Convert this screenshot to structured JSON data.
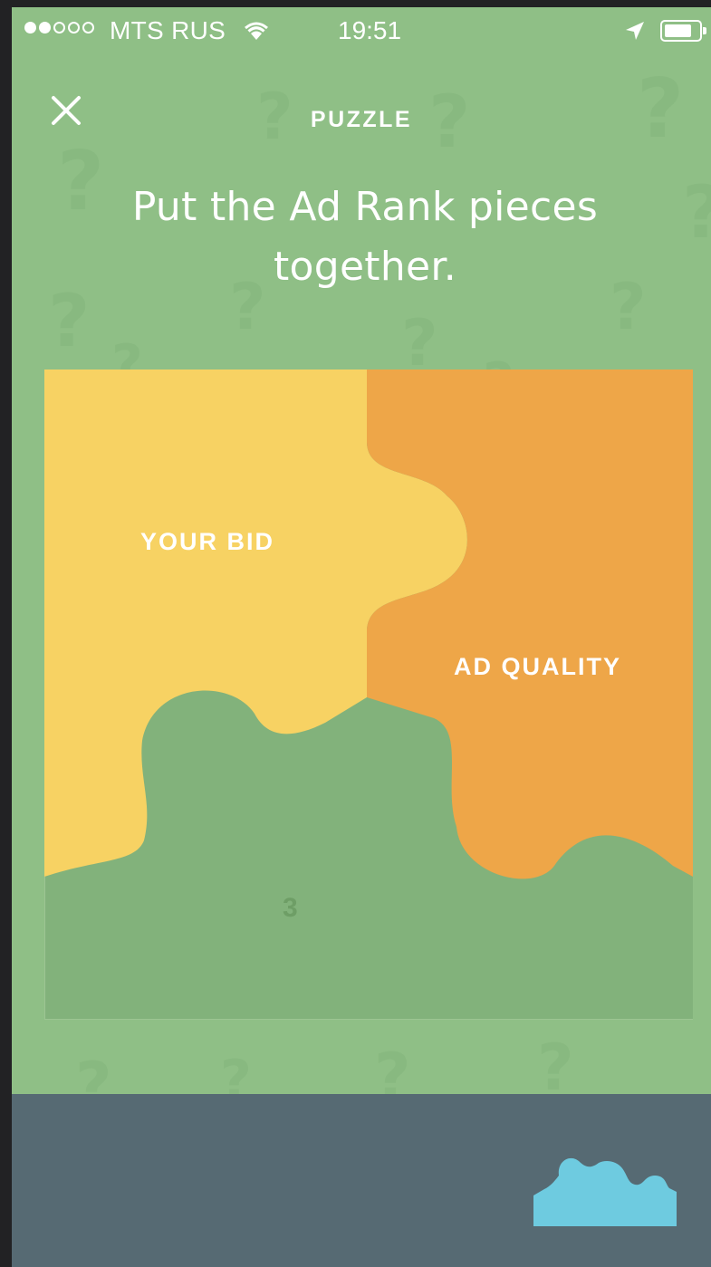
{
  "status_bar": {
    "carrier": "MTS RUS",
    "time": "19:51",
    "signal_dots_filled": 2,
    "signal_dots_total": 5,
    "battery_fraction": 0.8
  },
  "header": {
    "close_icon": "close-icon",
    "title": "PUZZLE"
  },
  "prompt": {
    "line1": "Put the Ad Rank pieces",
    "line2": "together."
  },
  "puzzle": {
    "pieces": [
      {
        "label": "YOUR BID",
        "color": "#f7d263"
      },
      {
        "label": "AD QUALITY",
        "color": "#eea648"
      }
    ],
    "empty_slot": {
      "label": "3",
      "color": "#82b27b"
    }
  },
  "tray": {
    "remaining_piece_color": "#6ecbe0",
    "remaining_piece_icon": "puzzle-piece-icon"
  },
  "colors": {
    "background": "#8fbf86",
    "tray_background": "#566a73"
  }
}
